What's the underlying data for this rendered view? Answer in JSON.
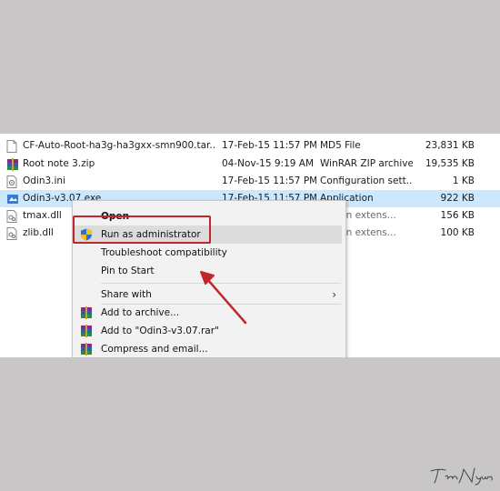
{
  "files": [
    {
      "name": "CF-Auto-Root-ha3g-ha3gxx-smn900.tar....",
      "date": "17-Feb-15 11:57 PM",
      "type": "MD5 File",
      "size": "23,831 KB",
      "icon": "text-file-icon"
    },
    {
      "name": "Root note 3.zip",
      "date": "04-Nov-15 9:19 AM",
      "type": "WinRAR ZIP archive",
      "size": "19,535 KB",
      "icon": "winrar-archive-icon"
    },
    {
      "name": "Odin3.ini",
      "date": "17-Feb-15 11:57 PM",
      "type": "Configuration sett...",
      "size": "1 KB",
      "icon": "settings-file-icon"
    },
    {
      "name": "Odin3-v3.07.exe",
      "date": "17-Feb-15 11:57 PM",
      "type": "Application",
      "size": "922 KB",
      "icon": "application-icon",
      "selected": true
    },
    {
      "name": "tmax.dll",
      "date": "",
      "type": "ication extens...",
      "size": "156 KB",
      "icon": "dll-file-icon"
    },
    {
      "name": "zlib.dll",
      "date": "",
      "type": "ication extens...",
      "size": "100 KB",
      "icon": "dll-file-icon"
    }
  ],
  "context_menu": {
    "open": "Open",
    "run_as_admin": "Run as administrator",
    "troubleshoot": "Troubleshoot compatibility",
    "pin_to_start": "Pin to Start",
    "share_with": "Share with",
    "add_to_archive": "Add to archive...",
    "add_to_rar": "Add to \"Odin3-v3.07.rar\"",
    "compress_email": "Compress and email..."
  },
  "colors": {
    "highlight_box": "#c0272d",
    "arrow": "#c0272d",
    "selection": "#cce8ff"
  },
  "signature": "Tâm Nguyễn"
}
